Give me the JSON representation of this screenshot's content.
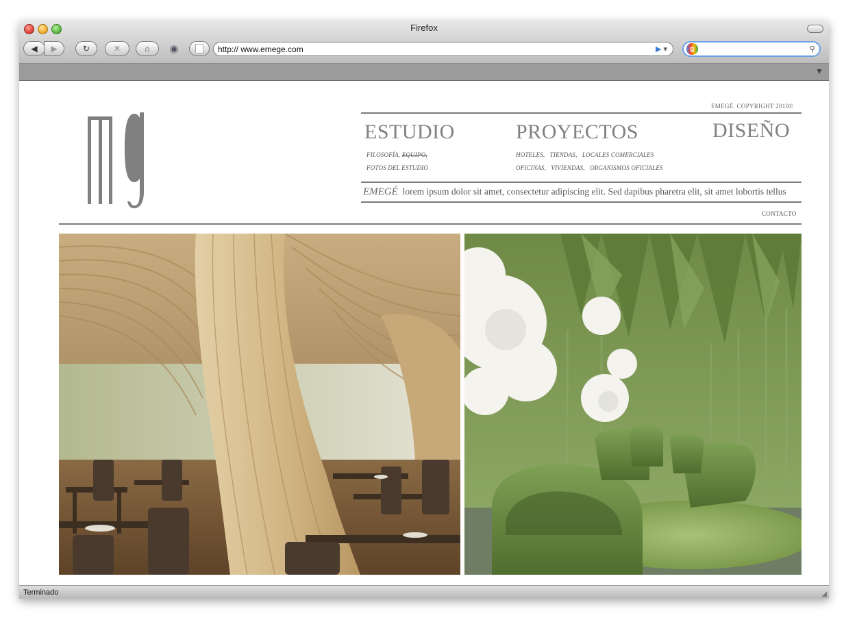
{
  "browser": {
    "title": "Firefox",
    "url": "http:// www.emege.com",
    "status": "Terminado"
  },
  "icons": [
    "back-icon",
    "forward-icon",
    "reload-icon",
    "stop-icon",
    "home-icon",
    "history-icon",
    "site-icon",
    "rss-icon",
    "search-icon",
    "bookmarks-menu-icon",
    "resize-grip-icon"
  ],
  "site": {
    "copyright": "EMEGÉ. COPYRIGHT 2010©",
    "nav": {
      "estudio": {
        "title": "ESTUDIO",
        "row1_a": "FILOSOFÍA,",
        "row1_b": "EQUIPO,",
        "row2": "FOTOS DEL ESTUDIO"
      },
      "proyectos": {
        "title": "PROYECTOS",
        "row1": "HOTELES,   TIENDAS,   LOCALES COMERCIALES",
        "row2": "OFICINAS,   VIVIENDAS,   ORGANISMOS OFICIALES"
      },
      "diseno": {
        "title": "DISEÑO"
      }
    },
    "tagline_brand": "EMEGÉ",
    "tagline_text": "lorem ipsum dolor sit amet, consectetur adipiscing elit. Sed dapibus pharetra elit, sit amet lobortis tellus",
    "contacto": "CONTACTO"
  },
  "colors": {
    "rule": "#7a7a7a",
    "text_gray": "#808080",
    "wood": "#d8c29a",
    "green": "#6e8c45"
  }
}
